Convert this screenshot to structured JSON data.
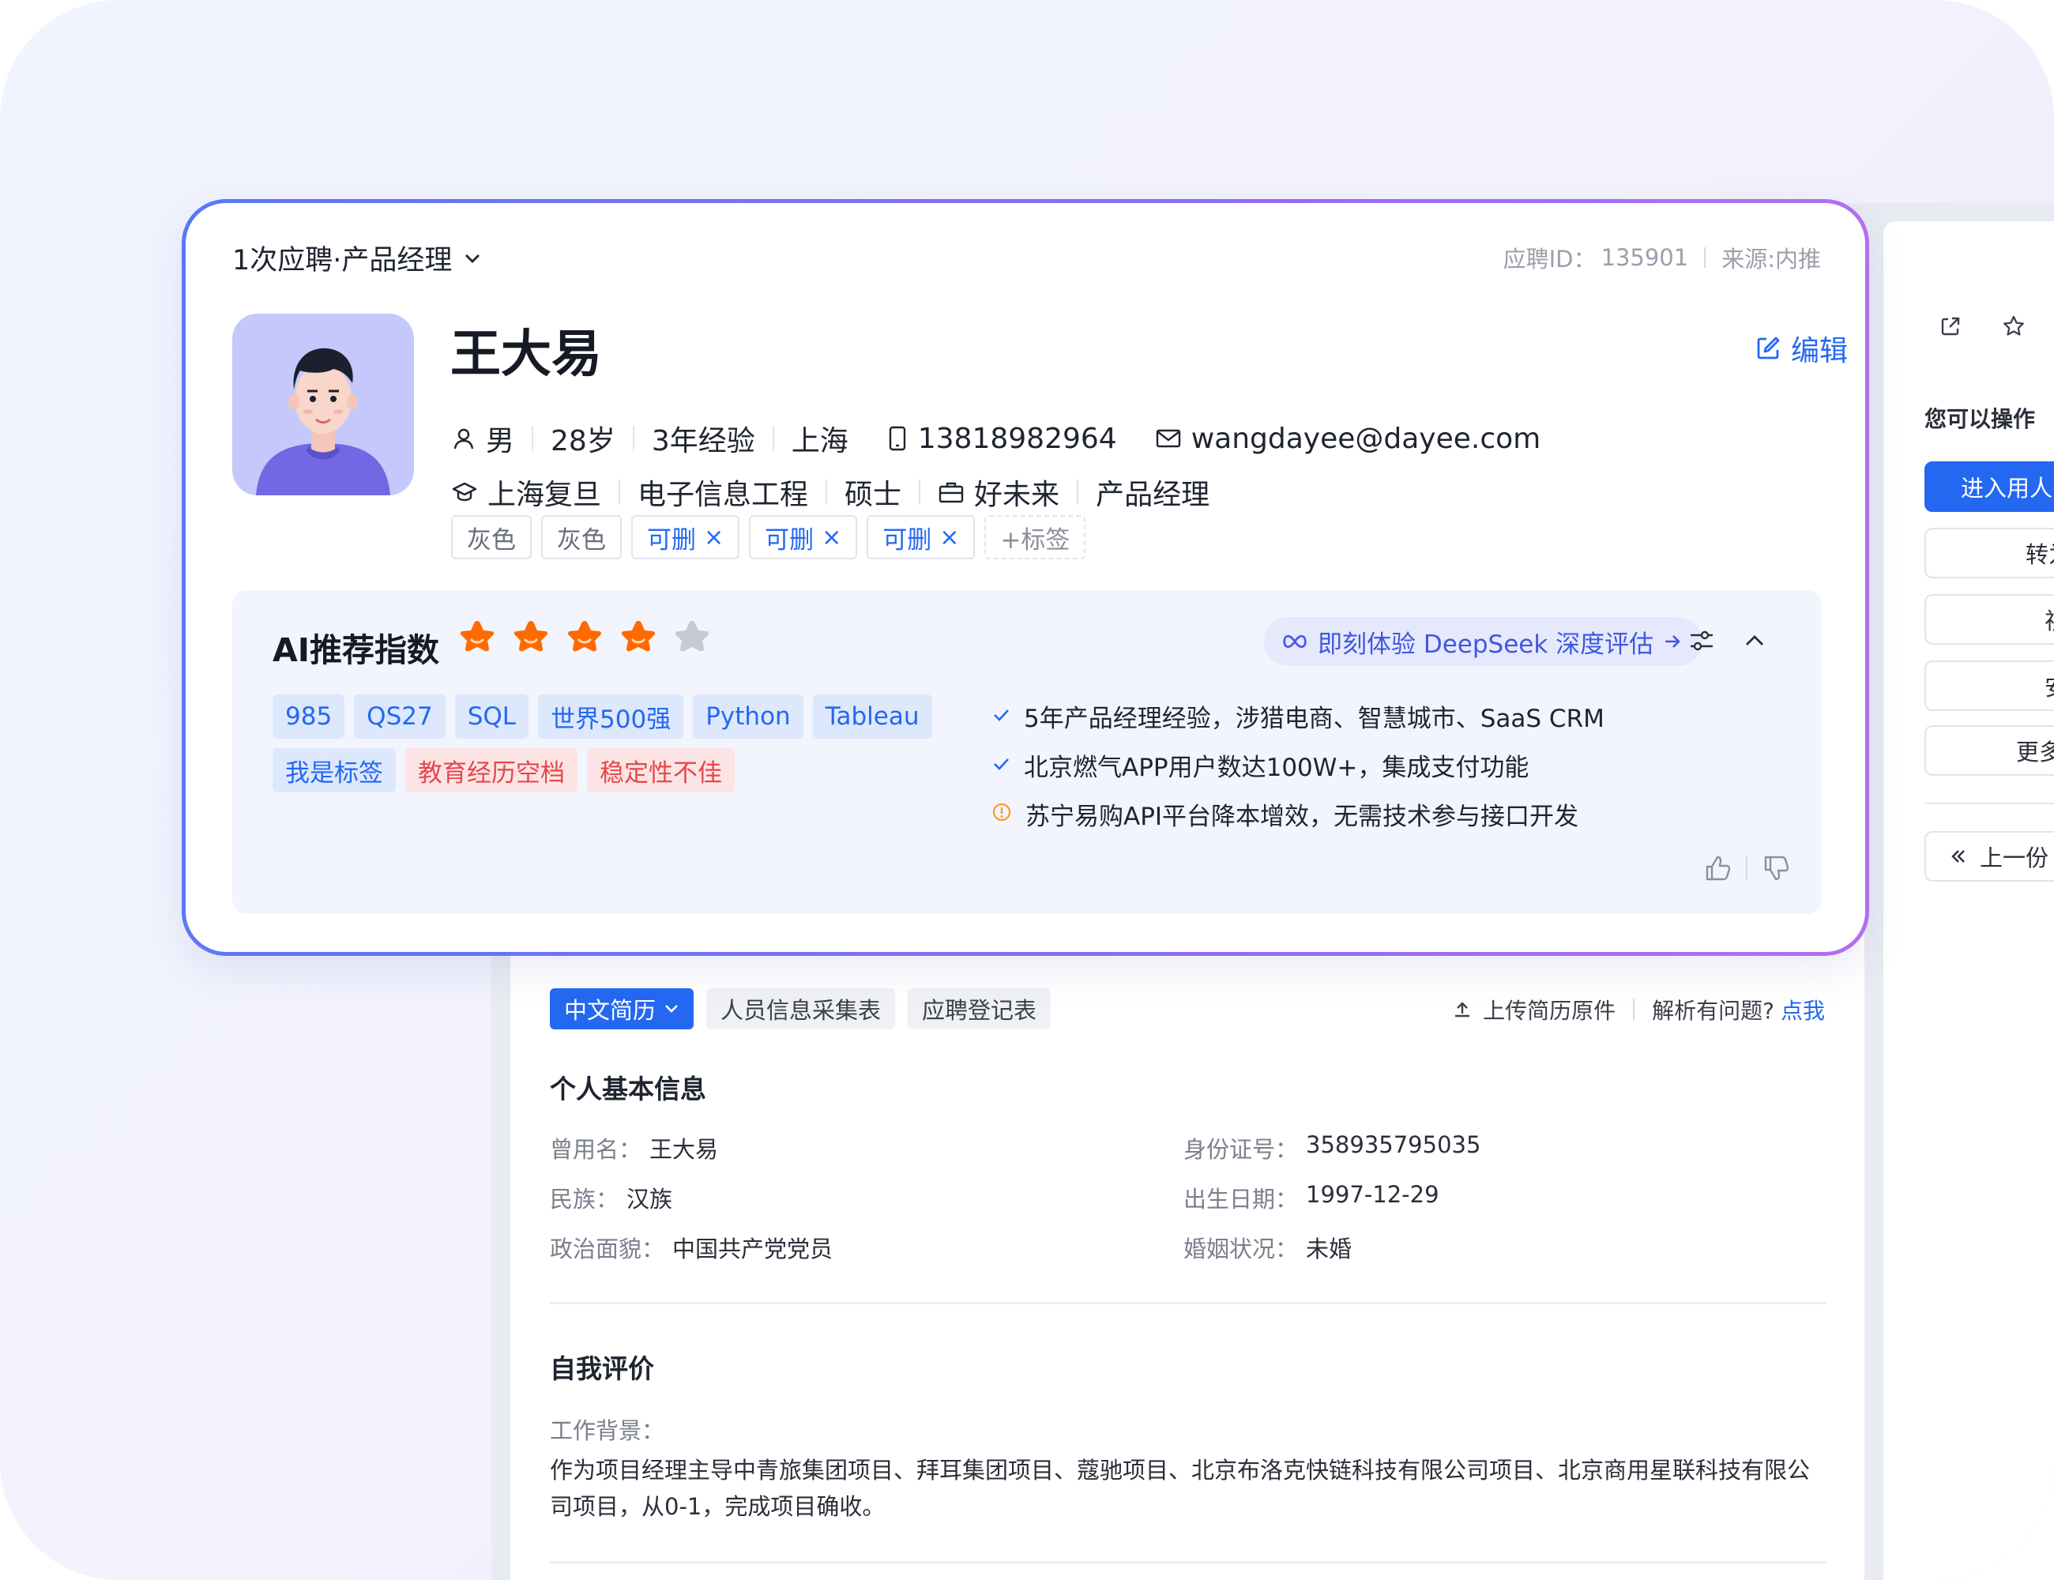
{
  "application": {
    "title": "1次应聘·产品经理",
    "id_label": "应聘ID：",
    "id_value": "135901",
    "source": "来源:内推"
  },
  "candidate": {
    "name": "王大易",
    "edit_label": "编辑",
    "gender": "男",
    "age": "28岁",
    "experience": "3年经验",
    "city": "上海",
    "phone": "13818982964",
    "email": "wangdayee@dayee.com",
    "school": "上海复旦",
    "major": "电子信息工程",
    "degree": "硕士",
    "company": "好未来",
    "position": "产品经理"
  },
  "tags": [
    {
      "label": "灰色",
      "removable": false
    },
    {
      "label": "灰色",
      "removable": false
    },
    {
      "label": "可删",
      "removable": true
    },
    {
      "label": "可删",
      "removable": true
    },
    {
      "label": "可删",
      "removable": true
    }
  ],
  "tag_remove_glyph": "×",
  "add_tag_label": "+标签",
  "ai": {
    "title": "AI推荐指数",
    "rating": 4,
    "max_rating": 5,
    "deepseek_label": "即刻体验 DeepSeek 深度评估",
    "chips": [
      {
        "label": "985",
        "tone": "blue"
      },
      {
        "label": "QS27",
        "tone": "blue"
      },
      {
        "label": "SQL",
        "tone": "blue"
      },
      {
        "label": "世界500强",
        "tone": "blue"
      },
      {
        "label": "Python",
        "tone": "blue"
      },
      {
        "label": "Tableau",
        "tone": "blue"
      },
      {
        "label": "我是标签",
        "tone": "blue"
      },
      {
        "label": "教育经历空档",
        "tone": "red"
      },
      {
        "label": "稳定性不佳",
        "tone": "red"
      }
    ],
    "points": [
      {
        "icon": "check",
        "text": "5年产品经理经验，涉猎电商、智慧城市、SaaS CRM"
      },
      {
        "icon": "check",
        "text": "北京燃气APP用户数达100W+，集成支付功能"
      },
      {
        "icon": "warning",
        "text": "苏宁易购API平台降本增效，无需技术参与接口开发"
      }
    ]
  },
  "resume": {
    "tabs": [
      "中文简历",
      "人员信息采集表",
      "应聘登记表"
    ],
    "upload_label": "上传简历原件",
    "parse_question": "解析有问题?",
    "parse_link": "点我",
    "basic_title": "个人基本信息",
    "fields": {
      "used_name": {
        "label": "曾用名：",
        "value": "王大易"
      },
      "nation": {
        "label": "民族：",
        "value": "汉族"
      },
      "political": {
        "label": "政治面貌：",
        "value": "中国共产党党员"
      },
      "id_card": {
        "label": "身份证号：",
        "value": "358935795035"
      },
      "birth": {
        "label": "出生日期：",
        "value": "1997-12-29"
      },
      "marital": {
        "label": "婚姻状况：",
        "value": "未婚"
      }
    },
    "self_eval_title": "自我评价",
    "work_bg_label": "工作背景：",
    "work_bg_text": "作为项目经理主导中青旅集团项目、拜耳集团项目、蔻驰项目、北京布洛克快链科技有限公司项目、北京商用星联科技有限公司项目，从0-1，完成项目确收。"
  },
  "sidebar": {
    "title": "您可以操作",
    "buttons": [
      "进入用人",
      "转为",
      "视",
      "安",
      "更多"
    ],
    "prev_label": "上一份"
  },
  "colors": {
    "primary": "#2468f2",
    "star": "#ff6a00",
    "star_empty": "#c7cad3",
    "danger": "#e5484d",
    "warning": "#ff9a1f"
  }
}
